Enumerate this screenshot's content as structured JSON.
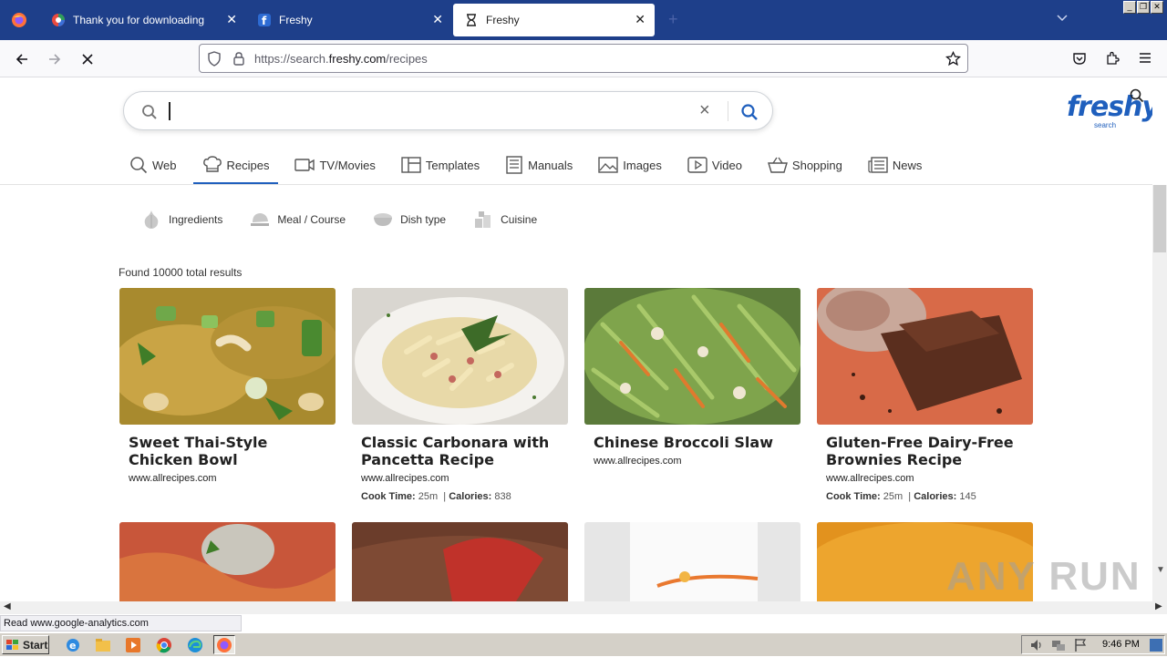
{
  "browser": {
    "tabs": [
      {
        "label": "Thank you for downloading",
        "active": false
      },
      {
        "label": "Freshy",
        "active": false
      },
      {
        "label": "Freshy",
        "active": true
      }
    ],
    "new_tab_label": "+",
    "url_prefix": "https://search.",
    "url_domain": "freshy.com",
    "url_path": "/recipes"
  },
  "search": {
    "logo_text": "freshy",
    "logo_subtext": "search",
    "clear_label": "×"
  },
  "categories": [
    {
      "label": "Web",
      "icon": "search-icon"
    },
    {
      "label": "Recipes",
      "icon": "chef-hat-icon",
      "active": true
    },
    {
      "label": "TV/Movies",
      "icon": "tv-icon"
    },
    {
      "label": "Templates",
      "icon": "template-icon"
    },
    {
      "label": "Manuals",
      "icon": "manual-icon"
    },
    {
      "label": "Images",
      "icon": "image-icon"
    },
    {
      "label": "Video",
      "icon": "video-icon"
    },
    {
      "label": "Shopping",
      "icon": "basket-icon"
    },
    {
      "label": "News",
      "icon": "news-icon"
    }
  ],
  "filters": [
    {
      "label": "Ingredients",
      "icon": "garlic-icon"
    },
    {
      "label": "Meal / Course",
      "icon": "meal-icon"
    },
    {
      "label": "Dish type",
      "icon": "dish-icon"
    },
    {
      "label": "Cuisine",
      "icon": "cuisine-icon"
    }
  ],
  "results_count_text": "Found 10000 total results",
  "recipes": [
    {
      "title": "Sweet Thai-Style Chicken Bowl",
      "site": "www.allrecipes.com",
      "cook_time": "",
      "calories": ""
    },
    {
      "title": "Classic Carbonara with Pancetta Recipe",
      "site": "www.allrecipes.com",
      "cook_time_label": "Cook Time:",
      "cook_time": "25m",
      "calories_label": "Calories:",
      "calories": "838"
    },
    {
      "title": "Chinese Broccoli Slaw",
      "site": "www.allrecipes.com",
      "cook_time": "",
      "calories": ""
    },
    {
      "title": "Gluten-Free Dairy-Free Brownies Recipe",
      "site": "www.allrecipes.com",
      "cook_time_label": "Cook Time:",
      "cook_time": "25m",
      "calories_label": "Calories:",
      "calories": "145"
    }
  ],
  "status_text": "Read www.google-analytics.com",
  "watermark_text": "ANY RUN",
  "taskbar": {
    "start_label": "Start",
    "clock": "9:46 PM"
  },
  "colors": {
    "brand": "#1f5fbd",
    "tabbar": "#1e3f8a"
  }
}
